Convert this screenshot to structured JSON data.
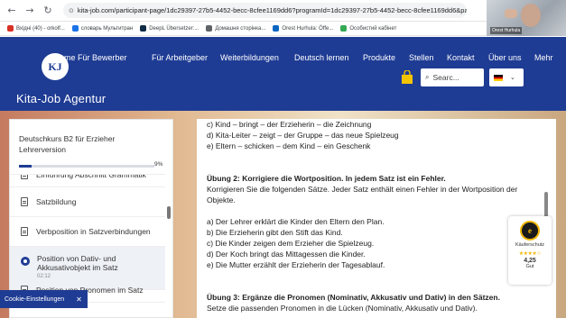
{
  "browser": {
    "url": "kita-job.com/participant-page/1dc29397-27b5-4452-becc-8cfee1169dd6?programId=1dc29397-27b5-4452-becc-8cfee1169dd6&participantId=129...",
    "back_icon": "←",
    "forward_icon": "→",
    "reload_icon": "↻"
  },
  "bookmarks": [
    {
      "label": "Вхідні (40) - orkolf...",
      "color": "#d93025"
    },
    {
      "label": "словарь Мультитран",
      "color": "#1a73e8"
    },
    {
      "label": "DeepL Übersetzer:...",
      "color": "#0f2b46"
    },
    {
      "label": "Домашня сторінка...",
      "color": "#5f6368"
    },
    {
      "label": "Orest Hurhula: Öffe...",
      "color": "#0a66c2"
    },
    {
      "label": "Особистий кабінет",
      "color": "#34a853"
    }
  ],
  "webcam": {
    "name": "Orest Hurhula"
  },
  "header": {
    "logo_text": "KJ",
    "nav": [
      "ome",
      "Für Bewerber",
      "Für Arbeitgeber",
      "Weiterbildungen",
      "Deutsch lernen",
      "Produkte",
      "Stellen",
      "Kontakt",
      "Über uns",
      "Mehr"
    ],
    "brand": "Kita-Job Agentur",
    "search_placeholder": "Searc...",
    "search_icon": "⌕",
    "chevron_icon": "⌄"
  },
  "course": {
    "title": "Deutschkurs B2 für Erzieher Lehrerversion",
    "progress_percent": 9,
    "progress_label": "9%",
    "lessons": [
      {
        "label": "Einführung Abschnitt Grammatik",
        "type": "cut"
      },
      {
        "label": "Satzbildung",
        "type": "doc"
      },
      {
        "label": "Verbposition in Satzverbindungen",
        "type": "doc"
      },
      {
        "label": "Position von Dativ- und Akkusativobjekt im Satz",
        "time": "02:12",
        "type": "active"
      },
      {
        "label": "Position von Pronomen im Satz",
        "type": "cut"
      }
    ]
  },
  "content": {
    "lines": [
      {
        "text": "c) Kind – bringt – der Erzieherin – die Zeichnung",
        "bold": false
      },
      {
        "text": "d) Kita-Leiter – zeigt – der Gruppe – das neue Spielzeug",
        "bold": false
      },
      {
        "text": "e) Eltern – schicken – dem Kind – ein Geschenk",
        "bold": false
      },
      {
        "text": "",
        "bold": false
      },
      {
        "text": "",
        "bold": false
      },
      {
        "text": "Übung 2: Korrigiere die Wortposition. In jedem Satz ist ein Fehler.",
        "bold": true
      },
      {
        "text": "Korrigieren Sie die folgenden Sätze. Jeder Satz enthält einen Fehler in der Wortposition der",
        "bold": false
      },
      {
        "text": "Objekte.",
        "bold": false
      },
      {
        "text": "",
        "bold": false
      },
      {
        "text": "a) Der Lehrer erklärt die Kinder den Eltern den Plan.",
        "bold": false
      },
      {
        "text": "b) Die Erzieherin gibt den Stift das Kind.",
        "bold": false
      },
      {
        "text": "c) Die Kinder zeigen dem Erzieher die Spielzeug.",
        "bold": false
      },
      {
        "text": "d) Der Koch bringt das Mittagessen die Kinder.",
        "bold": false
      },
      {
        "text": "e) Die Mutter erzählt der Erzieherin der Tagesablauf.",
        "bold": false
      },
      {
        "text": "",
        "bold": false
      },
      {
        "text": "",
        "bold": false
      },
      {
        "text": "Übung 3: Ergänze die Pronomen (Nominativ, Akkusativ und Dativ) in den Sätzen.",
        "bold": true
      },
      {
        "text": "Setze die passenden Pronomen in die Lücken (Nominativ, Akkusativ und Dativ).",
        "bold": false
      }
    ]
  },
  "trust_badge": {
    "seal": "e",
    "label": "Käuferschutz",
    "stars": "★★★★☆",
    "score": "4,25",
    "rating_word": "Gut"
  },
  "cookie": {
    "label": "Cookie-Einstellungen",
    "close_icon": "✕"
  }
}
